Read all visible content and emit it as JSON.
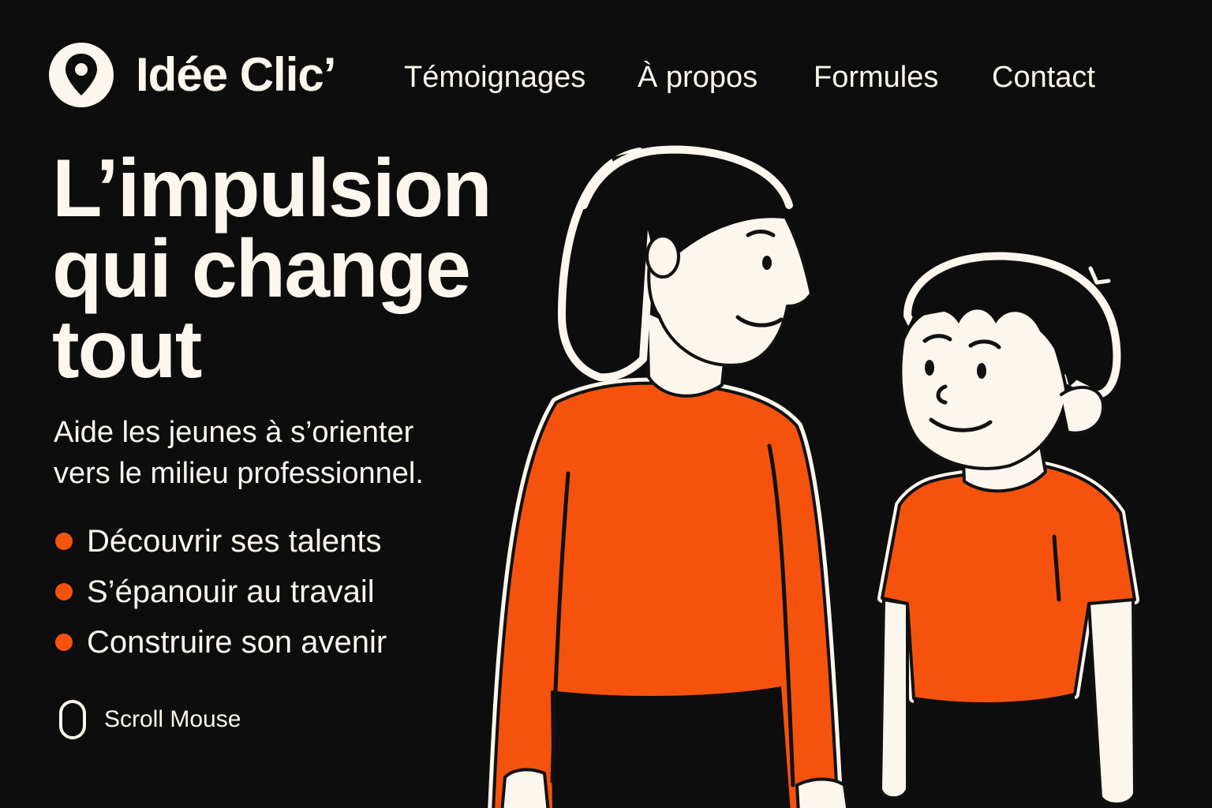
{
  "brand": {
    "name": "Idée Clic’",
    "icon": "map-pin-icon"
  },
  "nav": {
    "items": [
      {
        "label": "Témoignages"
      },
      {
        "label": "À propos"
      },
      {
        "label": "Formules"
      },
      {
        "label": "Contact"
      }
    ]
  },
  "hero": {
    "title_lines": [
      "L’impulsion",
      "qui change",
      "tout"
    ],
    "subtitle_lines": [
      "Aide les jeunes à s’orienter",
      "vers le milieu professionnel."
    ],
    "features": [
      {
        "label": "Découvrir ses talents"
      },
      {
        "label": "S’épanouir au travail"
      },
      {
        "label": "Construire son avenir"
      }
    ]
  },
  "scroll_hint": {
    "label": "Scroll Mouse",
    "icon": "mouse-icon"
  },
  "illustration": {
    "subject": "woman-and-boy-illustration"
  },
  "colors": {
    "background": "#0d0d0d",
    "text": "#fbf6ee",
    "accent": "#f5520e"
  }
}
